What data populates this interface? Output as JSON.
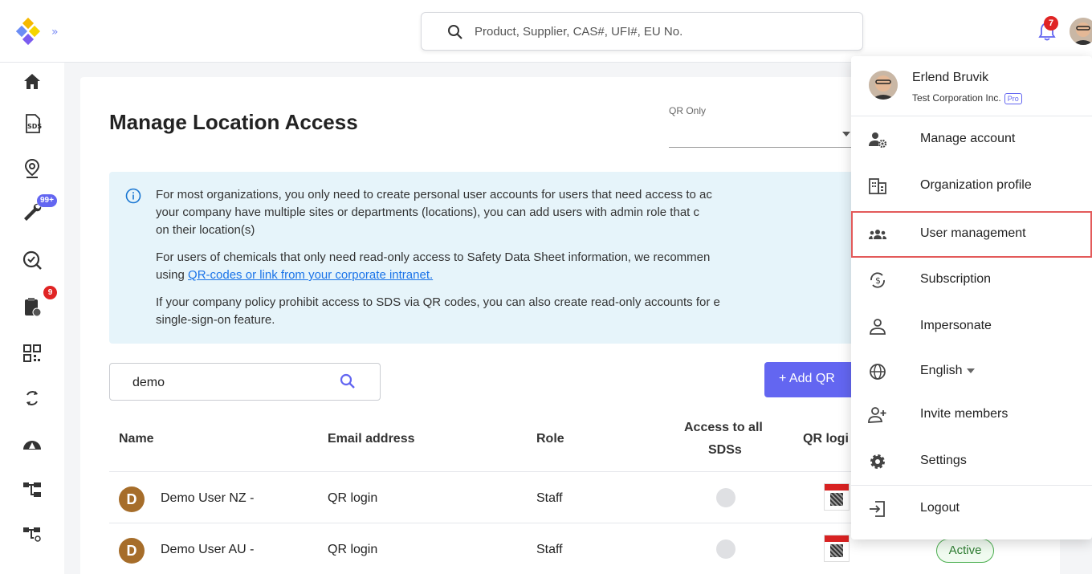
{
  "header": {
    "search_placeholder": "Product, Supplier, CAS#, UFI#, EU No.",
    "notifications_count": "7"
  },
  "sidebar": {
    "items": [
      {
        "name": "home",
        "badge": ""
      },
      {
        "name": "sds",
        "badge": ""
      },
      {
        "name": "location",
        "badge": ""
      },
      {
        "name": "tools",
        "badge": "99+"
      },
      {
        "name": "search-check",
        "badge": ""
      },
      {
        "name": "clipboard",
        "badge": "9"
      },
      {
        "name": "qr",
        "badge": ""
      },
      {
        "name": "sync",
        "badge": ""
      },
      {
        "name": "hazard",
        "badge": ""
      },
      {
        "name": "hierarchy",
        "badge": ""
      },
      {
        "name": "hierarchy-user",
        "badge": ""
      }
    ]
  },
  "page": {
    "title": "Manage Location Access",
    "qr_only_label": "QR Only",
    "info_lines": [
      "For most organizations, you only need to create personal user accounts for users that need access to ac",
      "your company have multiple sites or departments (locations), you can add users with admin role that c",
      "on their location(s)",
      "For users of chemicals that only need read-only access to Safety Data Sheet information, we recommen",
      "using",
      "QR-codes or link from your corporate intranet.",
      "If your company policy prohibit access to SDS via QR codes, you can also create read-only accounts for e",
      "single-sign-on feature."
    ],
    "filter_value": "demo",
    "add_button": "+  Add QR",
    "columns": {
      "name": "Name",
      "email": "Email address",
      "role": "Role",
      "access_line1": "Access to all",
      "access_line2": "SDSs",
      "qr": "QR logi"
    },
    "rows": [
      {
        "initial": "D",
        "name": "Demo User NZ -",
        "email": "QR login",
        "role": "Staff"
      },
      {
        "initial": "D",
        "name": "Demo User AU -",
        "email": "QR login",
        "role": "Staff"
      }
    ],
    "status_badge": "Active"
  },
  "menu": {
    "user_name": "Erlend Bruvik",
    "org_name": "Test Corporation Inc.",
    "plan_badge": "Pro",
    "items": [
      {
        "label": "Manage account",
        "icon": "user-gear-icon"
      },
      {
        "label": "Organization profile",
        "icon": "building-icon"
      },
      {
        "label": "User management",
        "icon": "users-icon"
      },
      {
        "label": "Subscription",
        "icon": "dollar-cycle-icon"
      },
      {
        "label": "Impersonate",
        "icon": "person-icon"
      },
      {
        "label": "English",
        "icon": "globe-icon"
      },
      {
        "label": "Invite members",
        "icon": "person-add-icon"
      },
      {
        "label": "Settings",
        "icon": "gear-icon"
      },
      {
        "label": "Logout",
        "icon": "logout-icon"
      }
    ]
  },
  "colors": {
    "accent": "#6366f1",
    "info_bg": "#e6f4fa",
    "badge_red": "#e02424",
    "highlight_outline": "#e35a5a",
    "user_avatar": "#a66d2a"
  }
}
